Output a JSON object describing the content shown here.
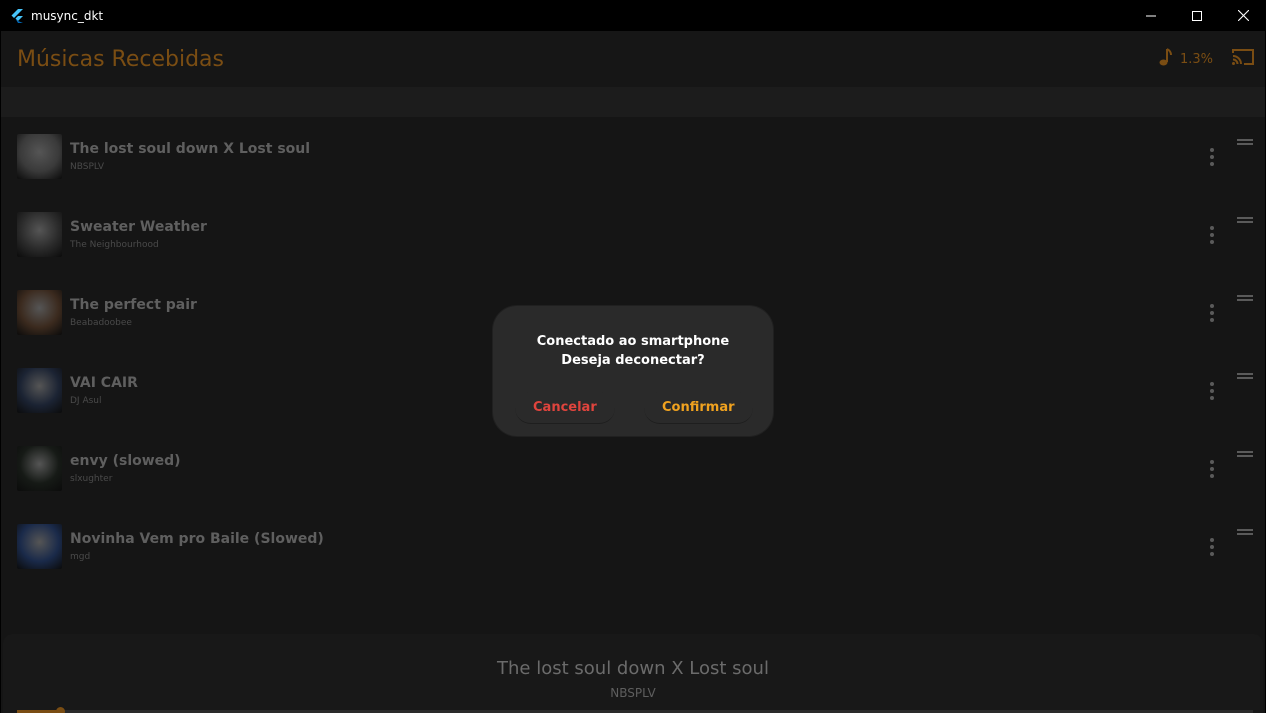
{
  "window": {
    "title": "musync_dkt",
    "app_icon": "flutter-icon",
    "controls": [
      "minimize-icon",
      "maximize-icon",
      "close-icon"
    ]
  },
  "appbar": {
    "title": "Músicas Recebidas",
    "volume_percent": "1.3%",
    "music_icon": "music-note-icon",
    "cast_icon": "cast-icon"
  },
  "tracks": [
    {
      "title": "The lost soul down X Lost soul",
      "artist": "NBSPLV",
      "thumb": "#3a3a3a"
    },
    {
      "title": "Sweater Weather",
      "artist": "The Neighbourhood",
      "thumb": "#2a2a2a"
    },
    {
      "title": "The perfect pair",
      "artist": "Beabadoobee",
      "thumb": "#3b2a1e"
    },
    {
      "title": "VAI CAIR",
      "artist": "DJ Asul",
      "thumb": "#1b2333"
    },
    {
      "title": "envy (slowed)",
      "artist": "slxughter",
      "thumb": "#161a16"
    },
    {
      "title": "Novinha Vem pro Baile (Slowed)",
      "artist": "mgd",
      "thumb": "#1a2a4a"
    }
  ],
  "now_playing": {
    "title": "The lost soul down X Lost soul",
    "artist": "NBSPLV",
    "progress": 0.035
  },
  "dialog": {
    "line1": "Conectado ao smartphone",
    "line2": "Deseja deconectar?",
    "cancel_label": "Cancelar",
    "confirm_label": "Confirmar"
  },
  "colors": {
    "accent": "#7a4d13",
    "cancel": "#e0443d",
    "confirm": "#f0a21f"
  }
}
